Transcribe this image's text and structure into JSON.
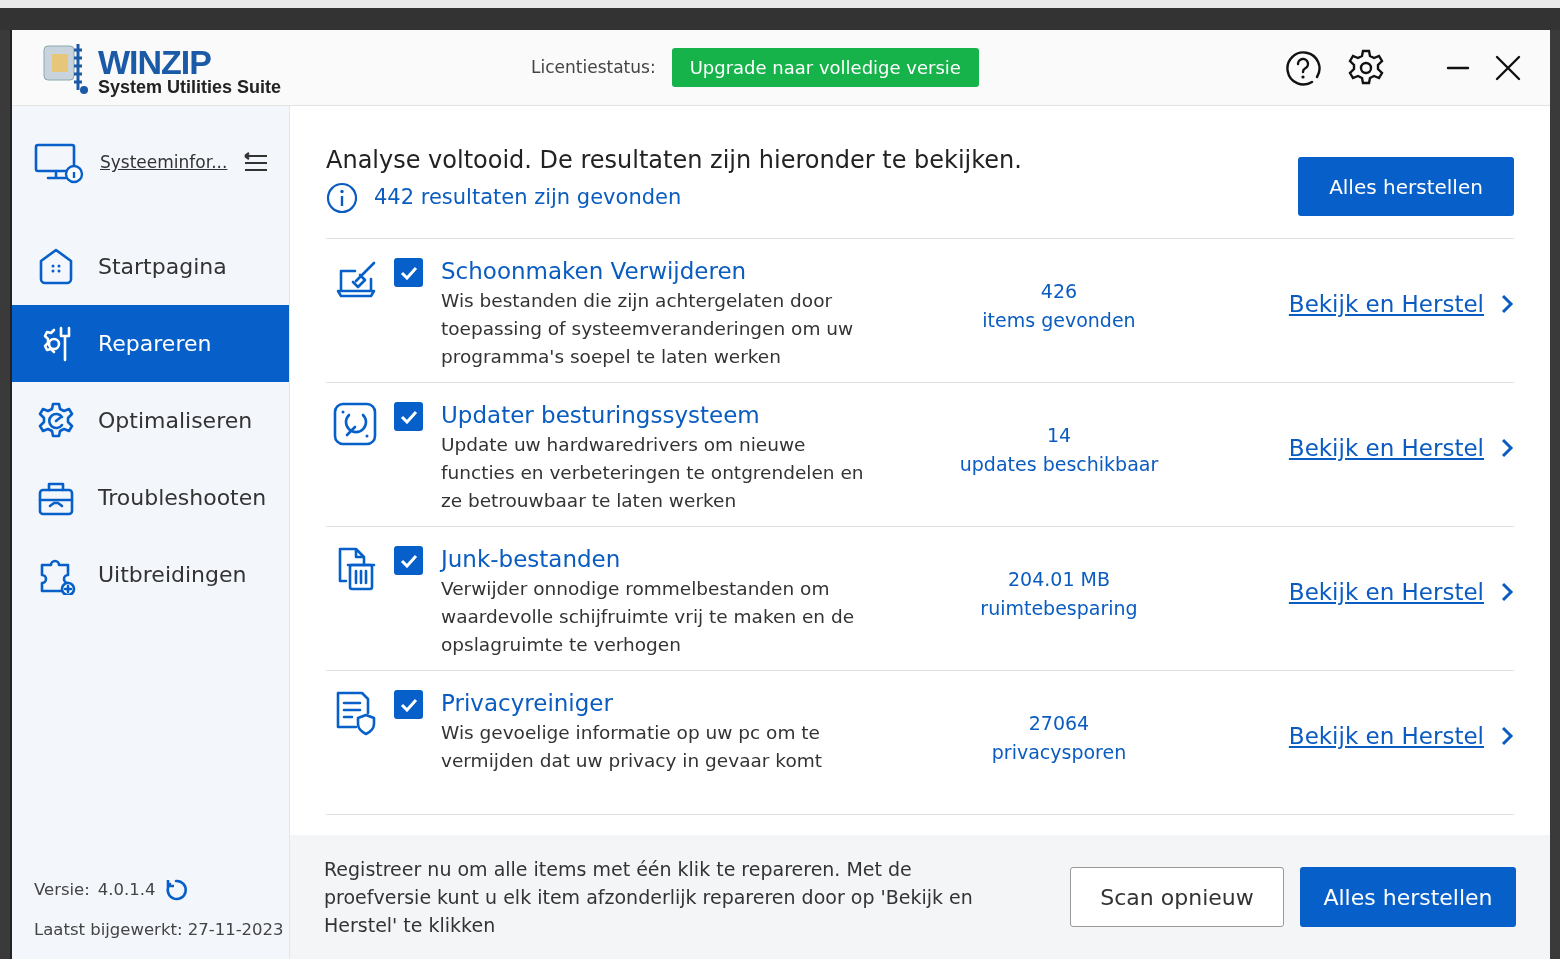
{
  "header": {
    "logo_title": "WINZIP",
    "logo_subtitle": "System Utilities Suite",
    "license_label": "Licentiestatus:",
    "upgrade_button": "Upgrade naar volledige versie"
  },
  "sidebar": {
    "system_info": "Systeeminfor...",
    "items": [
      {
        "label": "Startpagina",
        "selected": false
      },
      {
        "label": "Repareren",
        "selected": true
      },
      {
        "label": "Optimaliseren",
        "selected": false
      },
      {
        "label": "Troubleshooten",
        "selected": false
      },
      {
        "label": "Uitbreidingen",
        "selected": false
      }
    ],
    "version_label": "Versie:",
    "version": "4.0.1.4",
    "updated": "Laatst bijgewerkt: 27-11-2023"
  },
  "summary": {
    "title": "Analyse voltooid. De resultaten zijn hieronder te bekijken.",
    "count": "442 resultaten zijn gevonden",
    "button": "Alles herstellen"
  },
  "results": [
    {
      "checked": true,
      "title": "Schoonmaken Verwijderen",
      "description": "Wis bestanden die zijn achtergelaten door toepassing of systeemveranderingen om uw programma's soepel te laten werken",
      "count": "426",
      "unit": "items gevonden",
      "link": "Bekijk en Herstel"
    },
    {
      "checked": true,
      "title": "Updater besturingssysteem",
      "description": "Update uw hardwaredrivers om nieuwe functies en verbeteringen te ontgrendelen en ze betrouwbaar te laten werken",
      "count": "14",
      "unit": "updates beschikbaar",
      "link": "Bekijk en Herstel"
    },
    {
      "checked": true,
      "title": "Junk-bestanden",
      "description": "Verwijder onnodige rommelbestanden om waardevolle schijfruimte vrij te maken en de opslagruimte te verhogen",
      "count": "204.01 MB",
      "unit": "ruimtebesparing",
      "link": "Bekijk en Herstel"
    },
    {
      "checked": true,
      "title": "Privacyreiniger",
      "description": "Wis gevoelige informatie op uw pc om te vermijden dat uw privacy in gevaar komt",
      "count": "27064",
      "unit": "privacysporen",
      "link": "Bekijk en Herstel"
    }
  ],
  "footer": {
    "message": "Registreer nu om alle items met één klik te repareren. Met de proefversie kunt u elk item afzonderlijk repareren door op 'Bekijk en Herstel' te klikken",
    "rescan_button": "Scan opnieuw",
    "fix_button": "Alles herstellen"
  }
}
